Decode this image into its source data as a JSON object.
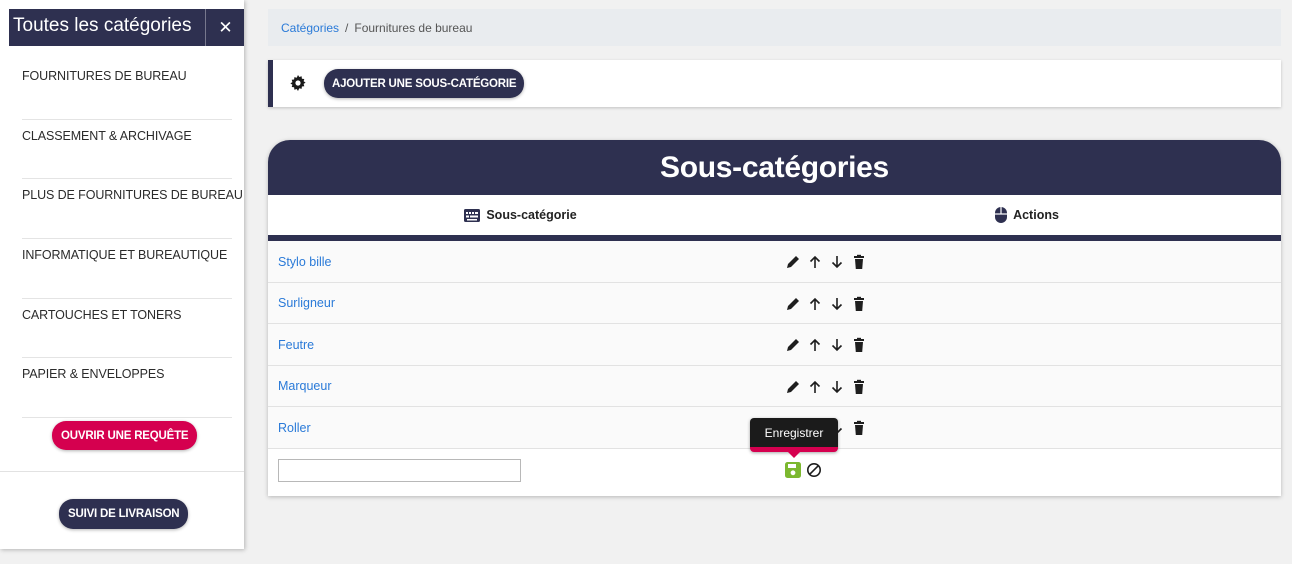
{
  "sidebar": {
    "title": "Toutes les catégories",
    "close": "✕",
    "items": [
      {
        "label": "FOURNITURES DE BUREAU"
      },
      {
        "label": "CLASSEMENT & ARCHIVAGE"
      },
      {
        "label": "PLUS DE FOURNITURES DE BUREAU"
      },
      {
        "label": "INFORMATIQUE ET BUREAUTIQUE"
      },
      {
        "label": "CARTOUCHES ET TONERS"
      },
      {
        "label": "PAPIER & ENVELOPPES"
      }
    ],
    "open_request_label": "OUVRIR UNE REQUÊTE",
    "delivery_label": "SUIVI DE LIVRAISON"
  },
  "breadcrumb": {
    "link": "Catégories",
    "separator": "/",
    "current": "Fournitures de bureau"
  },
  "toolbar": {
    "add_label": "AJOUTER UNE SOUS-CATÉGORIE"
  },
  "table": {
    "title": "Sous-catégories",
    "col_name": "Sous-catégorie",
    "col_actions": "Actions",
    "rows": [
      {
        "name": "Stylo bille"
      },
      {
        "name": "Surligneur"
      },
      {
        "name": "Feutre"
      },
      {
        "name": "Marqueur"
      },
      {
        "name": "Roller"
      }
    ],
    "new_value": ""
  },
  "tooltip": {
    "text": "Enregistrer"
  },
  "colors": {
    "primary": "#2e3050",
    "accent": "#d5004f",
    "link": "#2a7ad8",
    "save": "#7cb82f"
  },
  "icons": [
    "close-icon",
    "gear-icon",
    "keyboard-icon",
    "mouse-icon",
    "pencil-icon",
    "arrow-up-icon",
    "arrow-down-icon",
    "trash-icon",
    "save-icon",
    "cancel-icon"
  ]
}
